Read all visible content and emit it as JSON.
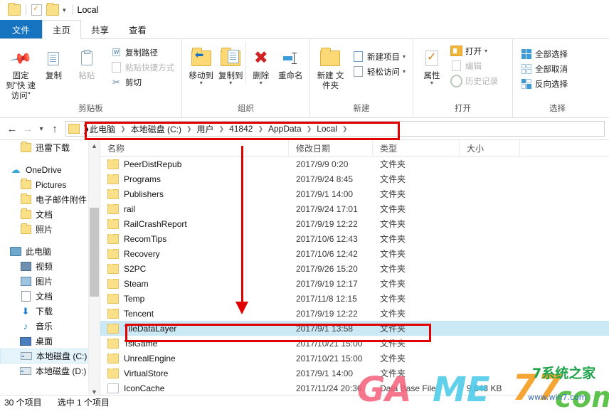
{
  "window": {
    "title": "Local",
    "quick_access": [
      "folder-icon",
      "properties-icon",
      "new-folder-icon",
      "customize-caret"
    ]
  },
  "ribbon": {
    "tabs": [
      {
        "label": "文件",
        "state": "file"
      },
      {
        "label": "主页",
        "state": "active"
      },
      {
        "label": "共享",
        "state": "normal"
      },
      {
        "label": "查看",
        "state": "normal"
      }
    ],
    "groups": [
      {
        "label": "剪贴板",
        "big": [
          {
            "label": "固定到\"快\n速访问\"",
            "icon": "pin-icon",
            "disabled": false
          },
          {
            "label": "复制",
            "icon": "copy-icon",
            "disabled": false
          },
          {
            "label": "粘贴",
            "icon": "paste-icon",
            "disabled": true
          }
        ],
        "small": [
          {
            "label": "复制路径",
            "icon": "copy-path-icon",
            "disabled": false
          },
          {
            "label": "粘贴快捷方式",
            "icon": "paste-shortcut-icon",
            "disabled": true
          },
          {
            "label": "剪切",
            "icon": "scissors-icon",
            "disabled": false
          }
        ]
      },
      {
        "label": "组织",
        "big": [
          {
            "label": "移动到",
            "icon": "move-to-icon",
            "dropdown": true
          },
          {
            "label": "复制到",
            "icon": "copy-to-icon",
            "dropdown": true
          },
          {
            "label": "删除",
            "icon": "delete-icon",
            "dropdown": true
          },
          {
            "label": "重命名",
            "icon": "rename-icon",
            "dropdown": false
          }
        ]
      },
      {
        "label": "新建",
        "big": [
          {
            "label": "新建\n文件夹",
            "icon": "new-folder-icon"
          }
        ],
        "small": [
          {
            "label": "新建项目",
            "icon": "new-item-icon",
            "dropdown": true
          },
          {
            "label": "轻松访问",
            "icon": "easy-access-icon",
            "dropdown": true
          }
        ]
      },
      {
        "label": "打开",
        "big": [
          {
            "label": "属性",
            "icon": "properties-icon",
            "dropdown": true
          }
        ],
        "small": [
          {
            "label": "打开",
            "icon": "open-icon",
            "dropdown": true,
            "disabled": false
          },
          {
            "label": "编辑",
            "icon": "edit-icon",
            "disabled": true
          },
          {
            "label": "历史记录",
            "icon": "history-icon",
            "disabled": true
          }
        ]
      },
      {
        "label": "选择",
        "small": [
          {
            "label": "全部选择",
            "icon": "select-all-icon"
          },
          {
            "label": "全部取消",
            "icon": "select-none-icon"
          },
          {
            "label": "反向选择",
            "icon": "invert-selection-icon"
          }
        ]
      }
    ]
  },
  "address": {
    "back_icon": "back-arrow-icon",
    "forward_icon": "forward-arrow-icon",
    "recent_icon": "recent-locations-icon",
    "up_icon": "up-arrow-icon",
    "breadcrumb": [
      "此电脑",
      "本地磁盘 (C:)",
      "用户",
      "41842",
      "AppData",
      "Local"
    ]
  },
  "nav_pane": {
    "items": [
      {
        "label": "迅雷下载",
        "icon": "folder-icon",
        "indent": 2
      },
      {
        "label": "OneDrive",
        "icon": "onedrive-cloud-icon",
        "indent": 1
      },
      {
        "label": "Pictures",
        "icon": "folder-icon",
        "indent": 2
      },
      {
        "label": "电子邮件附件",
        "icon": "folder-icon",
        "indent": 2
      },
      {
        "label": "文档",
        "icon": "folder-icon",
        "indent": 2
      },
      {
        "label": "照片",
        "icon": "folder-icon",
        "indent": 2
      },
      {
        "label": "此电脑",
        "icon": "this-pc-icon",
        "indent": 1
      },
      {
        "label": "视频",
        "icon": "videos-icon",
        "indent": 2
      },
      {
        "label": "图片",
        "icon": "pictures-icon",
        "indent": 2
      },
      {
        "label": "文档",
        "icon": "documents-icon",
        "indent": 2
      },
      {
        "label": "下载",
        "icon": "downloads-icon",
        "indent": 2
      },
      {
        "label": "音乐",
        "icon": "music-icon",
        "indent": 2
      },
      {
        "label": "桌面",
        "icon": "desktop-icon",
        "indent": 2
      },
      {
        "label": "本地磁盘 (C:)",
        "icon": "drive-icon",
        "indent": 2,
        "selected": true
      },
      {
        "label": "本地磁盘 (D:)",
        "icon": "drive-icon",
        "indent": 2
      }
    ]
  },
  "file_list": {
    "columns": [
      "名称",
      "修改日期",
      "类型",
      "大小"
    ],
    "rows": [
      {
        "name": "PeerDistRepub",
        "date": "2017/9/9 0:20",
        "type": "文件夹",
        "size": "",
        "icon": "folder-icon"
      },
      {
        "name": "Programs",
        "date": "2017/9/24 8:45",
        "type": "文件夹",
        "size": "",
        "icon": "folder-icon"
      },
      {
        "name": "Publishers",
        "date": "2017/9/1 14:00",
        "type": "文件夹",
        "size": "",
        "icon": "folder-icon"
      },
      {
        "name": "rail",
        "date": "2017/9/24 17:01",
        "type": "文件夹",
        "size": "",
        "icon": "folder-icon"
      },
      {
        "name": "RailCrashReport",
        "date": "2017/9/19 12:22",
        "type": "文件夹",
        "size": "",
        "icon": "folder-icon"
      },
      {
        "name": "RecomTips",
        "date": "2017/10/6 12:43",
        "type": "文件夹",
        "size": "",
        "icon": "folder-icon"
      },
      {
        "name": "Recovery",
        "date": "2017/10/6 12:42",
        "type": "文件夹",
        "size": "",
        "icon": "folder-icon"
      },
      {
        "name": "S2PC",
        "date": "2017/9/26 15:20",
        "type": "文件夹",
        "size": "",
        "icon": "folder-icon"
      },
      {
        "name": "Steam",
        "date": "2017/9/19 12:17",
        "type": "文件夹",
        "size": "",
        "icon": "folder-icon"
      },
      {
        "name": "Temp",
        "date": "2017/11/8 12:15",
        "type": "文件夹",
        "size": "",
        "icon": "folder-icon"
      },
      {
        "name": "Tencent",
        "date": "2017/9/19 12:22",
        "type": "文件夹",
        "size": "",
        "icon": "folder-icon"
      },
      {
        "name": "TileDataLayer",
        "date": "2017/9/1 13:58",
        "type": "文件夹",
        "size": "",
        "icon": "folder-icon",
        "selected": true
      },
      {
        "name": "TslGame",
        "date": "2017/10/21 15:00",
        "type": "文件夹",
        "size": "",
        "icon": "folder-icon"
      },
      {
        "name": "UnrealEngine",
        "date": "2017/10/21 15:00",
        "type": "文件夹",
        "size": "",
        "icon": "folder-icon"
      },
      {
        "name": "VirtualStore",
        "date": "2017/9/1 14:00",
        "type": "文件夹",
        "size": "",
        "icon": "folder-icon"
      },
      {
        "name": "IconCache",
        "date": "2017/11/24 20:36",
        "type": "Data Base File",
        "size": "9,648 KB",
        "icon": "file-icon"
      }
    ]
  },
  "status_bar": {
    "item_count": "30 个项目",
    "selection": "选中 1 个项目"
  },
  "annotations": {
    "color": "#e00000",
    "address_box": "breadcrumb-highlight",
    "row_box": "tiledatalayer-highlight",
    "arrow": "down-arrow-pointing-to-tiledatalayer"
  },
  "watermark": {
    "g1": "GA",
    "g2": "ME",
    "g3": "77",
    "g4": "com",
    "g5": "7系统之家",
    "g6": "www.win7.com"
  }
}
